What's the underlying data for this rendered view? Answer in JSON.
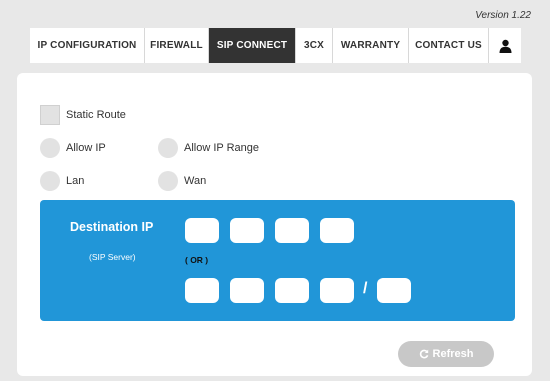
{
  "version": "Version 1.22",
  "nav": {
    "tabs": [
      "IP CONFIGURATION",
      "FIREWALL",
      "SIP CONNECT",
      "3CX",
      "WARRANTY",
      "CONTACT US"
    ],
    "active": "SIP CONNECT",
    "user_icon": "user-icon"
  },
  "options": {
    "static_route": "Static Route",
    "allow_ip": "Allow IP",
    "allow_ip_range": "Allow IP Range",
    "lan": "Lan",
    "wan": "Wan"
  },
  "destination": {
    "title": "Destination IP",
    "subtitle": "(SIP Server)",
    "or": "( OR )",
    "slash": "/",
    "ip1": [
      "",
      "",
      "",
      ""
    ],
    "ip2": [
      "",
      "",
      "",
      ""
    ],
    "mask": ""
  },
  "refresh": {
    "label": "Refresh",
    "icon": "refresh-icon"
  },
  "colors": {
    "accent": "#2196d8",
    "active_tab": "#333333",
    "button_disabled": "#c8c8c8"
  }
}
